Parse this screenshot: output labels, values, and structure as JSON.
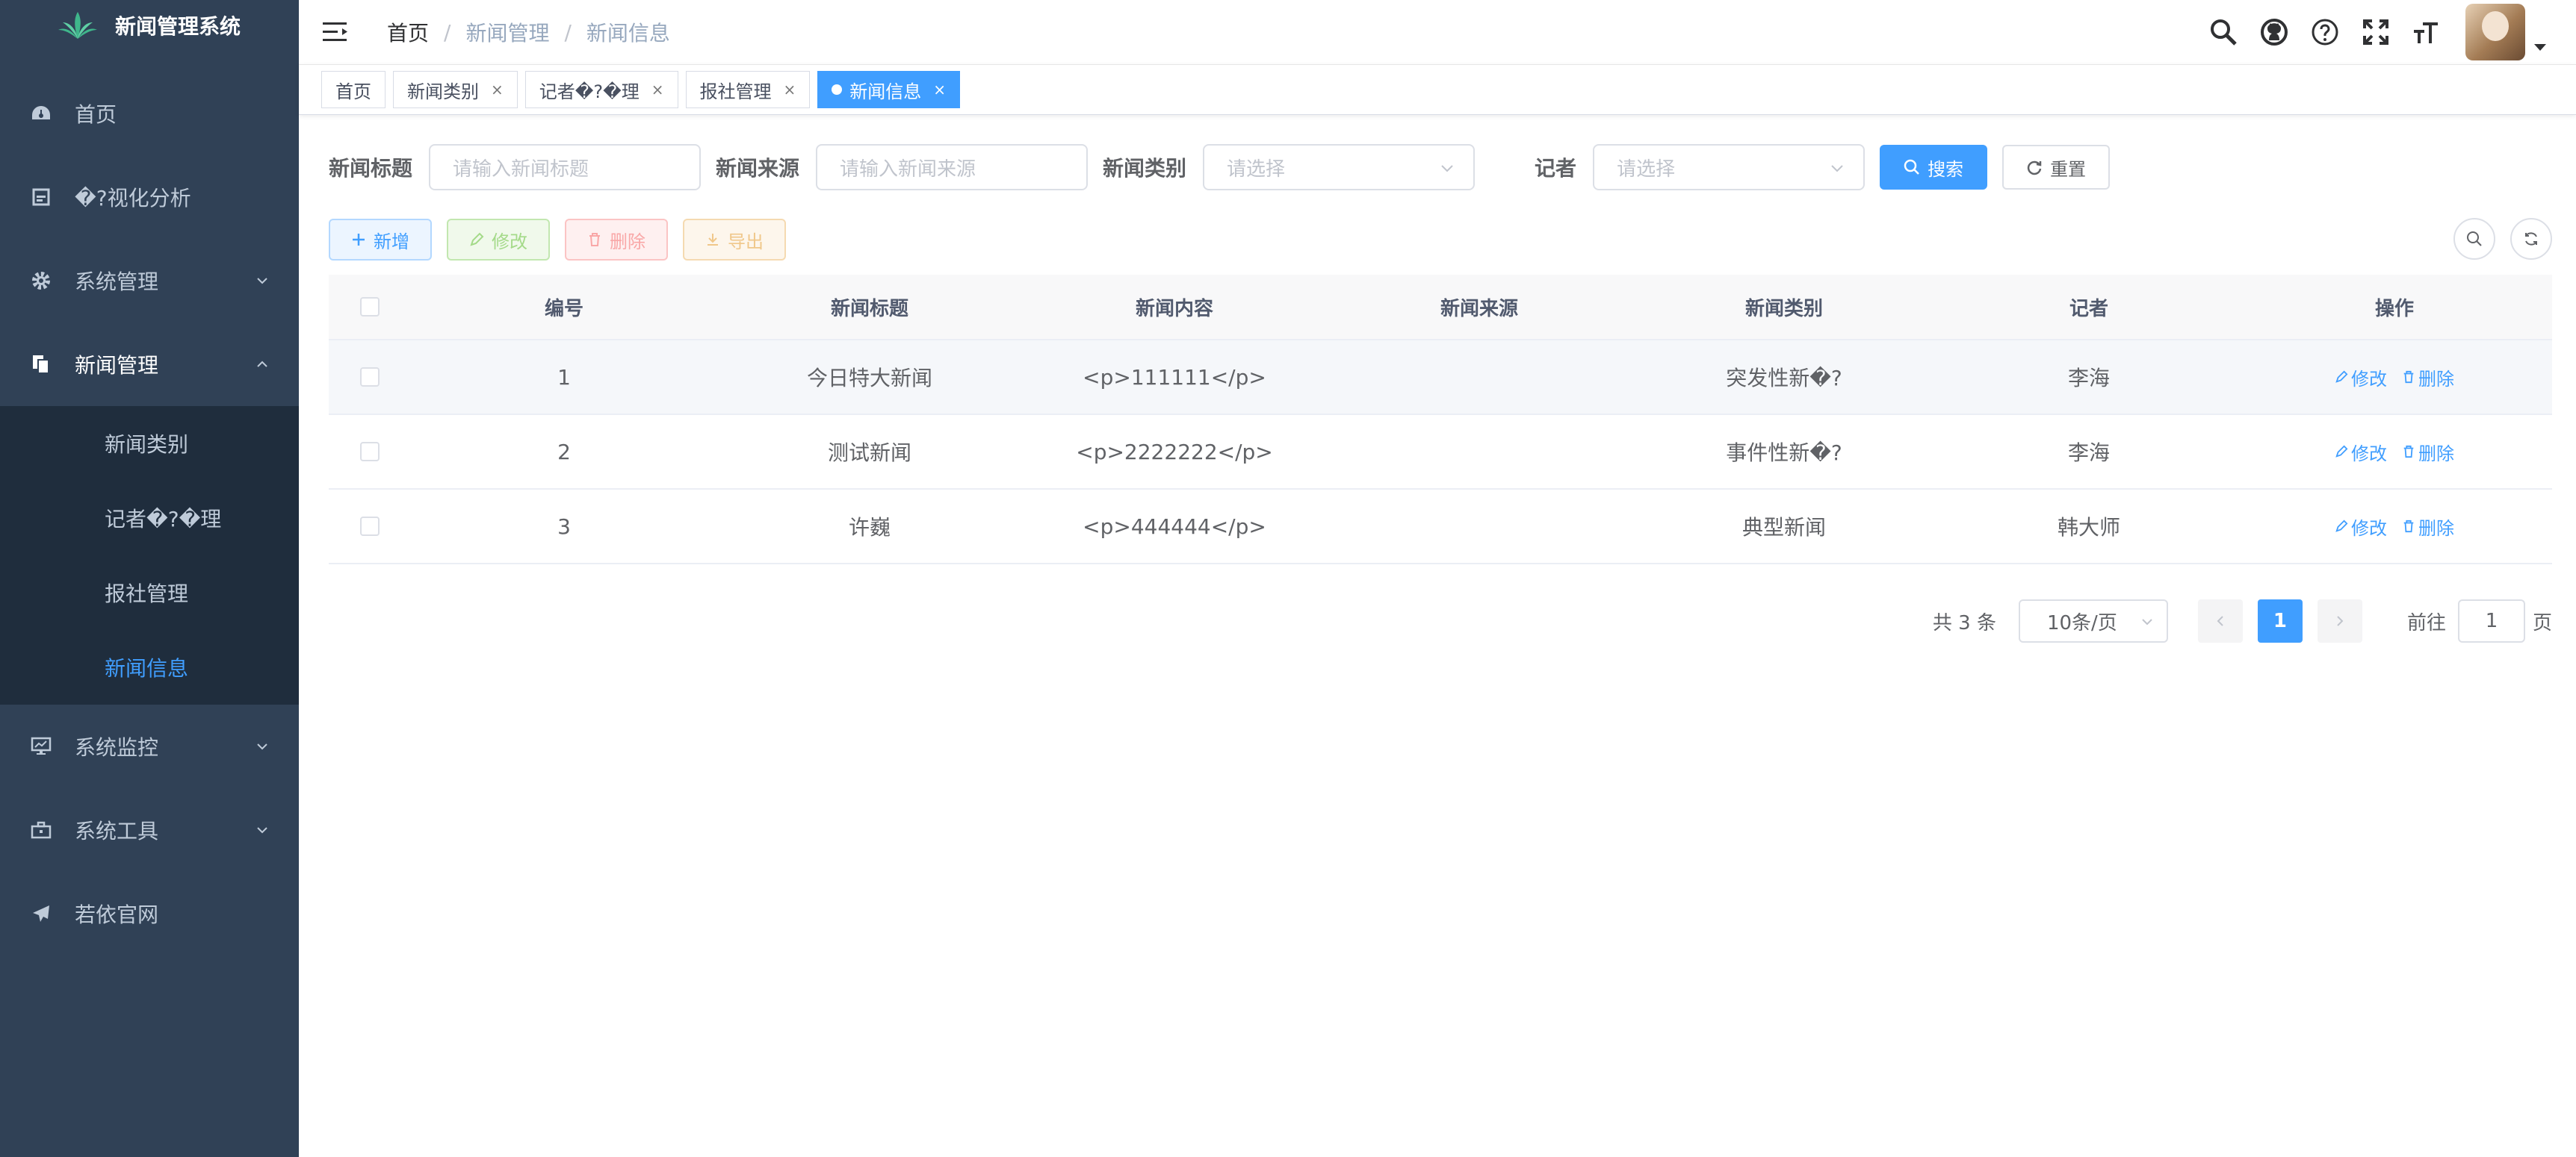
{
  "app": {
    "title": "新闻管理系统"
  },
  "sidebar": {
    "items": [
      {
        "label": "首页",
        "icon": "dashboard-icon"
      },
      {
        "label": "�?视化分析",
        "icon": "chart-icon"
      },
      {
        "label": "系统管理",
        "icon": "gear-icon"
      },
      {
        "label": "新闻管理",
        "icon": "documents-icon",
        "expanded": true
      },
      {
        "label": "系统监控",
        "icon": "monitor-icon"
      },
      {
        "label": "系统工具",
        "icon": "toolbox-icon"
      },
      {
        "label": "若依官网",
        "icon": "paper-plane-icon"
      }
    ],
    "submenu": [
      {
        "label": "新闻类别"
      },
      {
        "label": "记者�?�理"
      },
      {
        "label": "报社管理"
      },
      {
        "label": "新闻信息",
        "active": true
      }
    ]
  },
  "breadcrumb": [
    "首页",
    "新闻管理",
    "新闻信息"
  ],
  "tags": [
    {
      "label": "首页",
      "closable": false
    },
    {
      "label": "新闻类别",
      "closable": true
    },
    {
      "label": "记者�?�理",
      "closable": true
    },
    {
      "label": "报社管理",
      "closable": true
    },
    {
      "label": "新闻信息",
      "closable": true,
      "active": true
    }
  ],
  "tag_close": "×",
  "search": {
    "title_label": "新闻标题",
    "title_placeholder": "请输入新闻标题",
    "source_label": "新闻来源",
    "source_placeholder": "请输入新闻来源",
    "category_label": "新闻类别",
    "category_placeholder": "请选择",
    "reporter_label": "记者",
    "reporter_placeholder": "请选择",
    "search_button": "搜索",
    "reset_button": "重置"
  },
  "toolbar": {
    "add": "新增",
    "edit": "修改",
    "delete": "删除",
    "export": "导出"
  },
  "table": {
    "headers": [
      "编号",
      "新闻标题",
      "新闻内容",
      "新闻来源",
      "新闻类别",
      "记者",
      "操作"
    ],
    "rows": [
      {
        "id": "1",
        "title": "今日特大新闻",
        "content": "<p>111111</p>",
        "source": "",
        "category": "突发性新�?",
        "reporter": "李海"
      },
      {
        "id": "2",
        "title": "测试新闻",
        "content": "<p>2222222</p>",
        "source": "",
        "category": "事件性新�?",
        "reporter": "李海"
      },
      {
        "id": "3",
        "title": "许巍",
        "content": "<p>444444</p>",
        "source": "",
        "category": "典型新闻",
        "reporter": "韩大师"
      }
    ],
    "row_edit": "修改",
    "row_delete": "删除"
  },
  "pagination": {
    "total_text": "共 3 条",
    "page_size": "10条/页",
    "current_page": "1",
    "goto_label": "前往",
    "goto_value": "1",
    "page_suffix": "页"
  },
  "colors": {
    "primary": "#409eff",
    "sidebar_bg": "#304156",
    "submenu_bg": "#1f2d3d"
  }
}
